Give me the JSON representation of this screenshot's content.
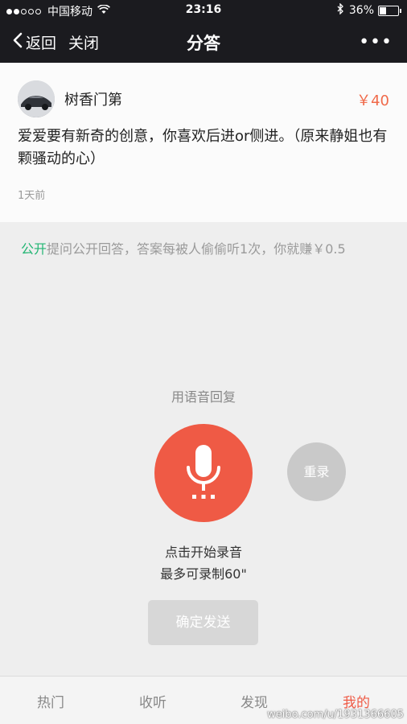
{
  "status_bar": {
    "carrier": "中国移动",
    "time": "23:16",
    "battery_label": "36%",
    "battery_level": 0.36,
    "signal_bars": 2
  },
  "nav": {
    "back_label": "返回",
    "close_label": "关闭",
    "title": "分答",
    "more_label": "•••"
  },
  "question": {
    "username": "树香门第",
    "price": "￥40",
    "text": "爱爱要有新奇的创意，你喜欢后进or侧进。（原来静姐也有颗骚动的心）",
    "time_ago": "1天前"
  },
  "public_note": {
    "highlight": "公开",
    "text": "提问公开回答，答案每被人偷偷听1次，你就赚￥0.5"
  },
  "record": {
    "label": "用语音回复",
    "redo_label": "重录",
    "hint_line1": "点击开始录音",
    "hint_line2": "最多可录制60\"",
    "send_label": "确定发送"
  },
  "tabs": [
    {
      "label": "热门"
    },
    {
      "label": "收听"
    },
    {
      "label": "发现"
    },
    {
      "label": "我的"
    }
  ],
  "watermark": "weibo.com/u/1931366605",
  "colors": {
    "accent": "#ef5a45",
    "public_green": "#22b573",
    "bar_bg": "#1b1b1f"
  }
}
